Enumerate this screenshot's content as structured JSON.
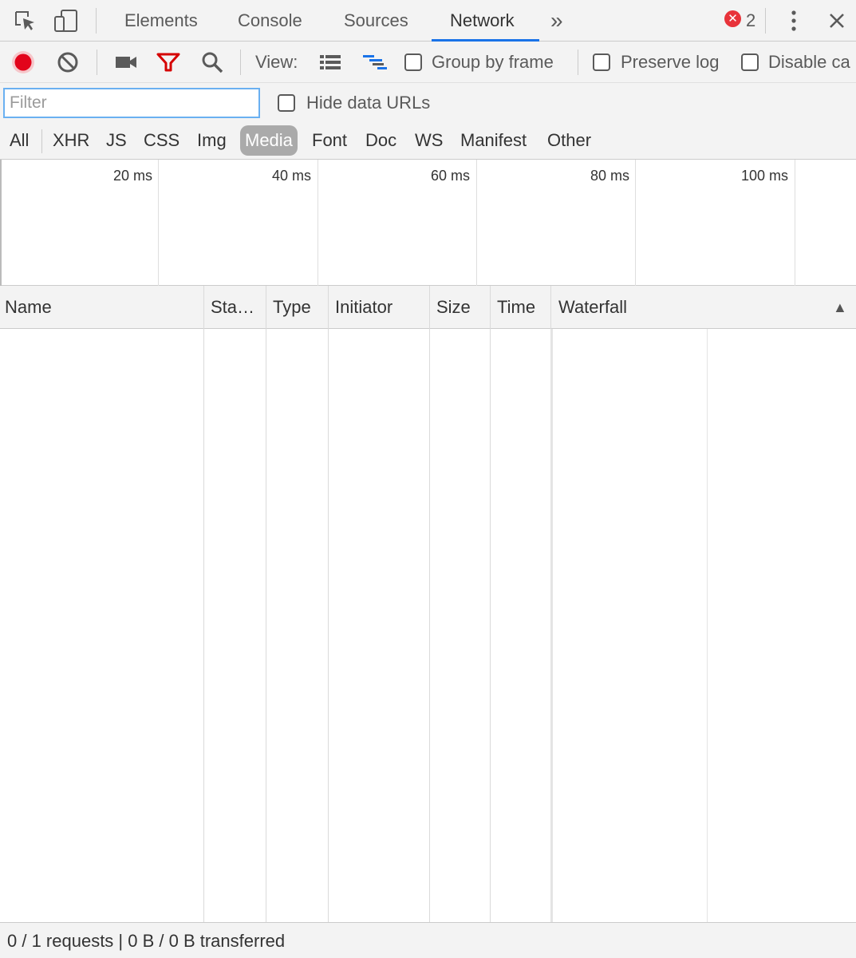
{
  "tabbar": {
    "tabs": [
      {
        "label": "Elements"
      },
      {
        "label": "Console"
      },
      {
        "label": "Sources"
      },
      {
        "label": "Network"
      }
    ],
    "active_tab": "Network",
    "more_label": "»",
    "error_count": "2",
    "icons": [
      "inspect-element-icon",
      "device-toolbar-icon",
      "error-icon",
      "more-menu-icon",
      "close-icon"
    ]
  },
  "toolbar": {
    "view_label": "View:",
    "group_by_frame_label": "Group by frame",
    "preserve_log_label": "Preserve log",
    "disable_cache_label": "Disable ca",
    "icons": [
      "record-icon",
      "clear-icon",
      "screenshot-camera-icon",
      "filter-icon",
      "search-icon",
      "large-rows-icon",
      "waterfall-view-icon"
    ],
    "colors": {
      "record": "#e2041b",
      "filter": "#d50000",
      "waterfall_accent": "#1a73e8"
    }
  },
  "filter": {
    "placeholder": "Filter",
    "value": "",
    "hide_data_urls_label": "Hide data URLs"
  },
  "types": {
    "items": [
      "All",
      "XHR",
      "JS",
      "CSS",
      "Img",
      "Media",
      "Font",
      "Doc",
      "WS",
      "Manifest",
      "Other"
    ],
    "selected": "Media"
  },
  "overview": {
    "ticks": [
      "20 ms",
      "40 ms",
      "60 ms",
      "80 ms",
      "100 ms"
    ]
  },
  "table": {
    "columns": [
      "Name",
      "Sta…",
      "Type",
      "Initiator",
      "Size",
      "Time",
      "Waterfall"
    ],
    "sort_indicator": "▲",
    "rows": []
  },
  "status": {
    "summary": "0 / 1 requests | 0 B / 0 B transferred"
  }
}
